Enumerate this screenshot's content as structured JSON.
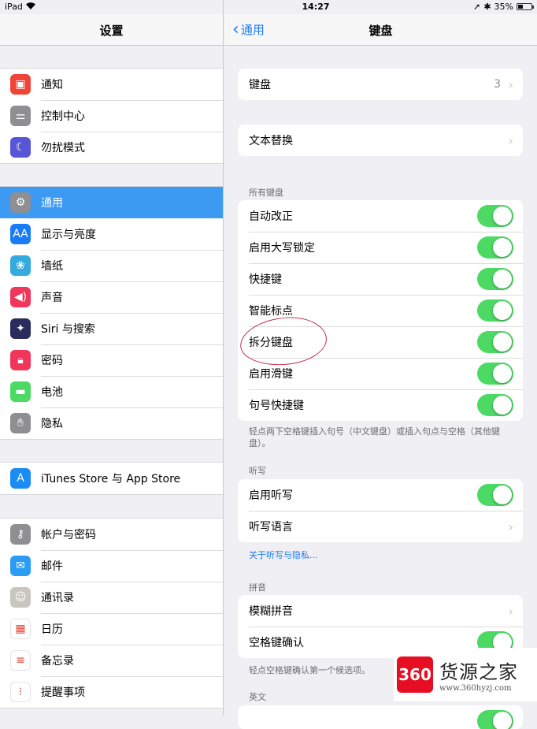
{
  "status_bar": {
    "device": "iPad",
    "time": "14:27",
    "battery": "35%",
    "battery_level": 0.35
  },
  "left": {
    "title": "设置",
    "groups": [
      [
        {
          "label": "通知",
          "icon": "notifications-icon",
          "color": "#f04438",
          "glyph": "▣"
        },
        {
          "label": "控制中心",
          "icon": "control-center-icon",
          "color": "#8e8e93",
          "glyph": "⚌"
        },
        {
          "label": "勿扰模式",
          "icon": "moon-icon",
          "color": "#5856d6",
          "glyph": "☾"
        }
      ],
      [
        {
          "label": "通用",
          "icon": "gear-icon",
          "color": "#8e8e93",
          "glyph": "⚙",
          "selected": true
        },
        {
          "label": "显示与亮度",
          "icon": "display-brightness-icon",
          "color": "#1a7cf4",
          "glyph": "AA"
        },
        {
          "label": "墙纸",
          "icon": "wallpaper-icon",
          "color": "#35aadc",
          "glyph": "❀"
        },
        {
          "label": "声音",
          "icon": "sound-icon",
          "color": "#f0365a",
          "glyph": "◀)"
        },
        {
          "label": "Siri 与搜索",
          "icon": "siri-icon",
          "color": "#2b2b5e",
          "glyph": "✦"
        },
        {
          "label": "密码",
          "icon": "passcode-icon",
          "color": "#f0365a",
          "glyph": "🔒︎"
        },
        {
          "label": "电池",
          "icon": "battery-icon",
          "color": "#4cd964",
          "glyph": "▬"
        },
        {
          "label": "隐私",
          "icon": "privacy-hand-icon",
          "color": "#8e8e93",
          "glyph": "✋︎"
        }
      ],
      [
        {
          "label": "iTunes Store 与 App Store",
          "icon": "app-store-icon",
          "color": "#1a8cf4",
          "glyph": "A"
        }
      ],
      [
        {
          "label": "帐户与密码",
          "icon": "key-icon",
          "color": "#8e8e93",
          "glyph": "⚷"
        },
        {
          "label": "邮件",
          "icon": "mail-icon",
          "color": "#2a9cf4",
          "glyph": "✉"
        },
        {
          "label": "通讯录",
          "icon": "contacts-icon",
          "color": "#c9c6bf",
          "glyph": "☺"
        },
        {
          "label": "日历",
          "icon": "calendar-icon",
          "color": "#ffffff",
          "glyph": "▦"
        },
        {
          "label": "备忘录",
          "icon": "notes-icon",
          "color": "#ffffff",
          "glyph": "≡"
        },
        {
          "label": "提醒事项",
          "icon": "reminders-icon",
          "color": "#ffffff",
          "glyph": "⁝"
        }
      ]
    ]
  },
  "right": {
    "back_label": "通用",
    "title": "键盘",
    "keyboards": {
      "label": "键盘",
      "value": "3"
    },
    "text_replacement": {
      "label": "文本替换"
    },
    "all_keyboards": {
      "header": "所有键盘",
      "items": [
        {
          "label": "自动改正",
          "on": true
        },
        {
          "label": "启用大写锁定",
          "on": true
        },
        {
          "label": "快捷键",
          "on": true
        },
        {
          "label": "智能标点",
          "on": true
        },
        {
          "label": "拆分键盘",
          "on": true
        },
        {
          "label": "启用滑键",
          "on": true
        },
        {
          "label": "句号快捷键",
          "on": true
        }
      ],
      "footer": "轻点两下空格键插入句号（中文键盘）或插入句点与空格（其他键盘）。"
    },
    "dictation": {
      "header": "听写",
      "enable": {
        "label": "启用听写",
        "on": true
      },
      "language": {
        "label": "听写语言"
      },
      "link": "关于听写与隐私..."
    },
    "pinyin": {
      "header": "拼音",
      "fuzzy": {
        "label": "模糊拼音"
      },
      "space_confirm": {
        "label": "空格键确认",
        "on": true
      },
      "footer": "轻点空格键确认第一个候选项。"
    },
    "english": {
      "header": "英文"
    }
  },
  "watermark": {
    "logo": "360",
    "title": "货源之家",
    "url": "www.360hyzj.com"
  },
  "colors": {
    "accent": "#1a7cf4",
    "toggle_on": "#4cd964",
    "selected": "#3d9af2"
  }
}
